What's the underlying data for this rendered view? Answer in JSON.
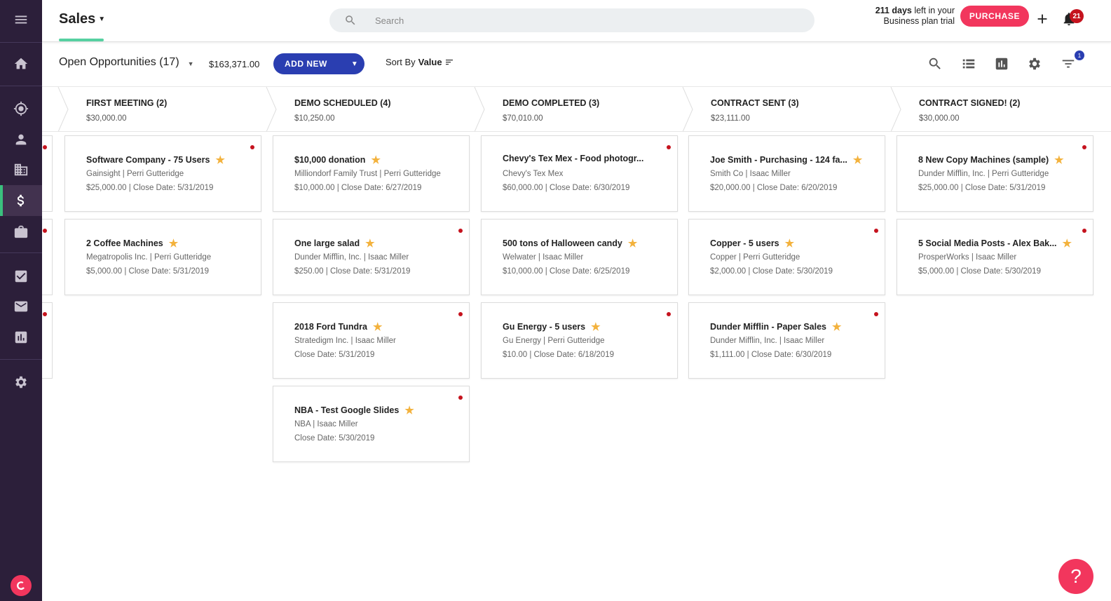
{
  "header": {
    "title": "Sales",
    "search_placeholder": "Search",
    "trial_days": "211 days",
    "trial_rest": " left in your Business plan trial",
    "purchase_label": "PURCHASE",
    "notification_count": "21"
  },
  "toolbar": {
    "view_label": "Open Opportunities (17)",
    "total": "$163,371.00",
    "add_new_label": "ADD NEW",
    "sort_prefix": "Sort By",
    "sort_value": "Value",
    "filter_badge": "1"
  },
  "stages": [
    {
      "name": "FIRST MEETING (2)",
      "value": "$30,000.00"
    },
    {
      "name": "DEMO SCHEDULED (4)",
      "value": "$10,250.00"
    },
    {
      "name": "DEMO COMPLETED (3)",
      "value": "$70,010.00"
    },
    {
      "name": "CONTRACT SENT (3)",
      "value": "$23,111.00"
    },
    {
      "name": "CONTRACT SIGNED! (2)",
      "value": "$30,000.00"
    }
  ],
  "cards": {
    "first_meeting": [
      {
        "name": "Software Company - 75 Users",
        "line1": "Gainsight | Perri Gutteridge",
        "line2": "$25,000.00 | Close Date: 5/31/2019"
      },
      {
        "name": "2 Coffee Machines",
        "line1": "Megatropolis Inc. | Perri Gutteridge",
        "line2": "$5,000.00 | Close Date: 5/31/2019"
      }
    ],
    "demo_scheduled": [
      {
        "name": "$10,000 donation",
        "line1": "Milliondorf Family Trust | Perri Gutteridge",
        "line2": "$10,000.00 | Close Date: 6/27/2019"
      },
      {
        "name": "One large salad",
        "line1": "Dunder Mifflin, Inc. | Isaac Miller",
        "line2": "$250.00 | Close Date: 5/31/2019"
      },
      {
        "name": "2018 Ford Tundra",
        "line1": "Stratedigm Inc. | Isaac Miller",
        "line2": "Close Date: 5/31/2019"
      },
      {
        "name": "NBA - Test Google Slides",
        "line1": "NBA | Isaac Miller",
        "line2": "Close Date: 5/30/2019"
      }
    ],
    "demo_completed": [
      {
        "name": "Chevy's Tex Mex - Food photogr...",
        "line1": "Chevy's Tex Mex",
        "line2": "$60,000.00 | Close Date: 6/30/2019"
      },
      {
        "name": "500 tons of Halloween candy",
        "line1": "Welwater | Isaac Miller",
        "line2": "$10,000.00 | Close Date: 6/25/2019"
      },
      {
        "name": "Gu Energy - 5 users",
        "line1": "Gu Energy | Perri Gutteridge",
        "line2": "$10.00 | Close Date: 6/18/2019"
      }
    ],
    "contract_sent": [
      {
        "name": "Joe Smith - Purchasing - 124 fa...",
        "line1": "Smith Co | Isaac Miller",
        "line2": "$20,000.00 | Close Date: 6/20/2019"
      },
      {
        "name": "Copper - 5 users",
        "line1": "Copper | Perri Gutteridge",
        "line2": "$2,000.00 | Close Date: 5/30/2019"
      },
      {
        "name": "Dunder Mifflin - Paper Sales",
        "line1": "Dunder Mifflin, Inc. | Isaac Miller",
        "line2": "$1,111.00 | Close Date: 6/30/2019"
      }
    ],
    "contract_signed": [
      {
        "name": "8 New Copy Machines (sample)",
        "line1": "Dunder Mifflin, Inc. | Perri Gutteridge",
        "line2": "$25,000.00 | Close Date: 5/31/2019"
      },
      {
        "name": "5 Social Media Posts - Alex Bak...",
        "line1": "ProsperWorks | Isaac Miller",
        "line2": "$5,000.00 | Close Date: 5/30/2019"
      }
    ]
  },
  "help_label": "?",
  "colors": {
    "sidebar": "#2c1f3a",
    "accent": "#f2365d",
    "primary": "#2a3eb1",
    "active_indicator": "#3ac07e",
    "star": "#f3b23d",
    "overdue_dot": "#c5131e"
  }
}
